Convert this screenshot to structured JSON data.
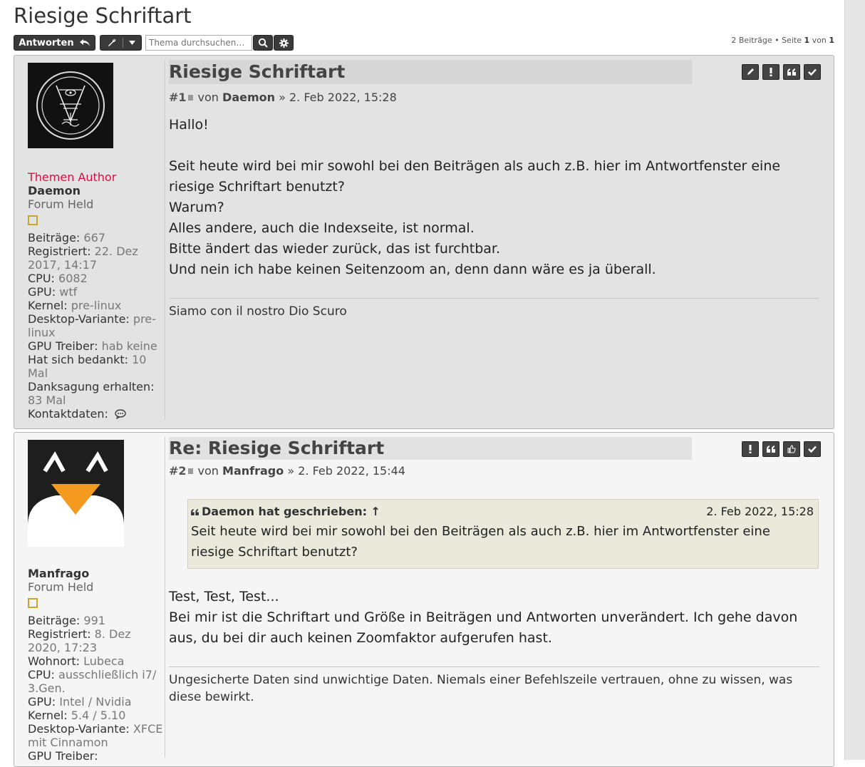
{
  "page": {
    "title": "Riesige Schriftart"
  },
  "toolbar": {
    "reply_label": "Antworten",
    "search_placeholder": "Thema durchsuchen…",
    "posts_count": "2 Beiträge",
    "page_label": "Seite",
    "page_current": "1",
    "page_of": "von",
    "page_total": "1"
  },
  "posts": [
    {
      "title": "Riesige Schriftart",
      "number": "#1",
      "by": "von",
      "author": "Daemon",
      "date": "» 2. Feb 2022, 15:28",
      "profile": {
        "author_label": "Themen Author",
        "name": "Daemon",
        "rank": "Forum Held",
        "fields": [
          {
            "k": "Beiträge:",
            "v": "667"
          },
          {
            "k": "Registriert:",
            "v": "22. Dez 2017, 14:17"
          },
          {
            "k": "CPU:",
            "v": "6082"
          },
          {
            "k": "GPU:",
            "v": "wtf"
          },
          {
            "k": "Kernel:",
            "v": "pre-linux"
          },
          {
            "k": "Desktop-Variante:",
            "v": "pre-linux"
          },
          {
            "k": "GPU Treiber:",
            "v": "hab keine"
          },
          {
            "k": "Hat sich bedankt:",
            "v": "10 Mal"
          },
          {
            "k": "Danksagung erhalten:",
            "v": "83 Mal"
          },
          {
            "k": "Kontaktdaten:",
            "v": ""
          }
        ]
      },
      "content": [
        "Hallo!",
        "",
        "Seit heute wird bei mir sowohl bei den Beiträgen als auch z.B. hier im Antwortfenster eine riesige Schriftart benutzt?",
        "Warum?",
        "Alles andere, auch die Indexseite, ist normal.",
        "Bitte ändert das wieder zurück, das ist furchtbar.",
        "Und nein ich habe keinen Seitenzoom an, denn dann wäre es ja überall."
      ],
      "signature": "Siamo con il nostro Dio Scuro"
    },
    {
      "title": "Re: Riesige Schriftart",
      "number": "#2",
      "by": "von",
      "author": "Manfrago",
      "date": "» 2. Feb 2022, 15:44",
      "profile": {
        "name": "Manfrago",
        "rank": "Forum Held",
        "fields": [
          {
            "k": "Beiträge:",
            "v": "991"
          },
          {
            "k": "Registriert:",
            "v": "8. Dez 2020, 17:23"
          },
          {
            "k": "Wohnort:",
            "v": "Lubeca"
          },
          {
            "k": "CPU:",
            "v": "ausschließlich i7/ 3.Gen."
          },
          {
            "k": "GPU:",
            "v": "Intel / Nvidia"
          },
          {
            "k": "Kernel:",
            "v": "5.4 / 5.10"
          },
          {
            "k": "Desktop-Variante:",
            "v": "XFCE mit Cinnamon"
          },
          {
            "k": "GPU Treiber:",
            "v": ""
          }
        ]
      },
      "quote": {
        "author": "Daemon hat geschrieben: ↑",
        "date": "2. Feb 2022, 15:28",
        "text": "Seit heute wird bei mir sowohl bei den Beiträgen als auch z.B. hier im Antwortfenster eine riesige Schriftart benutzt?"
      },
      "content": [
        "Test, Test, Test...",
        "Bei mir ist die Schriftart und Größe in Beiträgen und Antworten unverändert. Ich gehe davon aus, du bei dir auch keinen Zoomfaktor aufgerufen hast."
      ],
      "signature": "Ungesicherte Daten sind unwichtige Daten. Niemals einer Befehlszeile vertrauen, ohne zu wissen, was diese bewirkt."
    }
  ]
}
